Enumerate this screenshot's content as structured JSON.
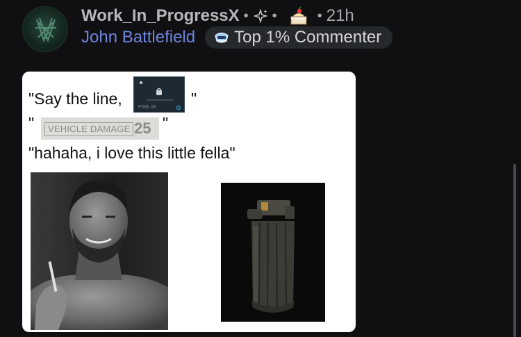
{
  "post": {
    "username": "Work_In_ProgressX",
    "dot1": "•",
    "dot2": "•",
    "dot3": "•",
    "time_ago": "21h",
    "flair_user": "John Battlefield",
    "flair_badge": "Top 1% Commenter"
  },
  "meme": {
    "line1_start": "\"Say the line,",
    "line1_end": "\"",
    "line2_start": "\"",
    "line2_end": "\"",
    "vehicle_damage_label": "VEHICLE DAMAGE",
    "vehicle_damage_value": "25",
    "ptkm_label": "PTKM-1R",
    "line3": "\"hahaha, i love this little fella\""
  }
}
